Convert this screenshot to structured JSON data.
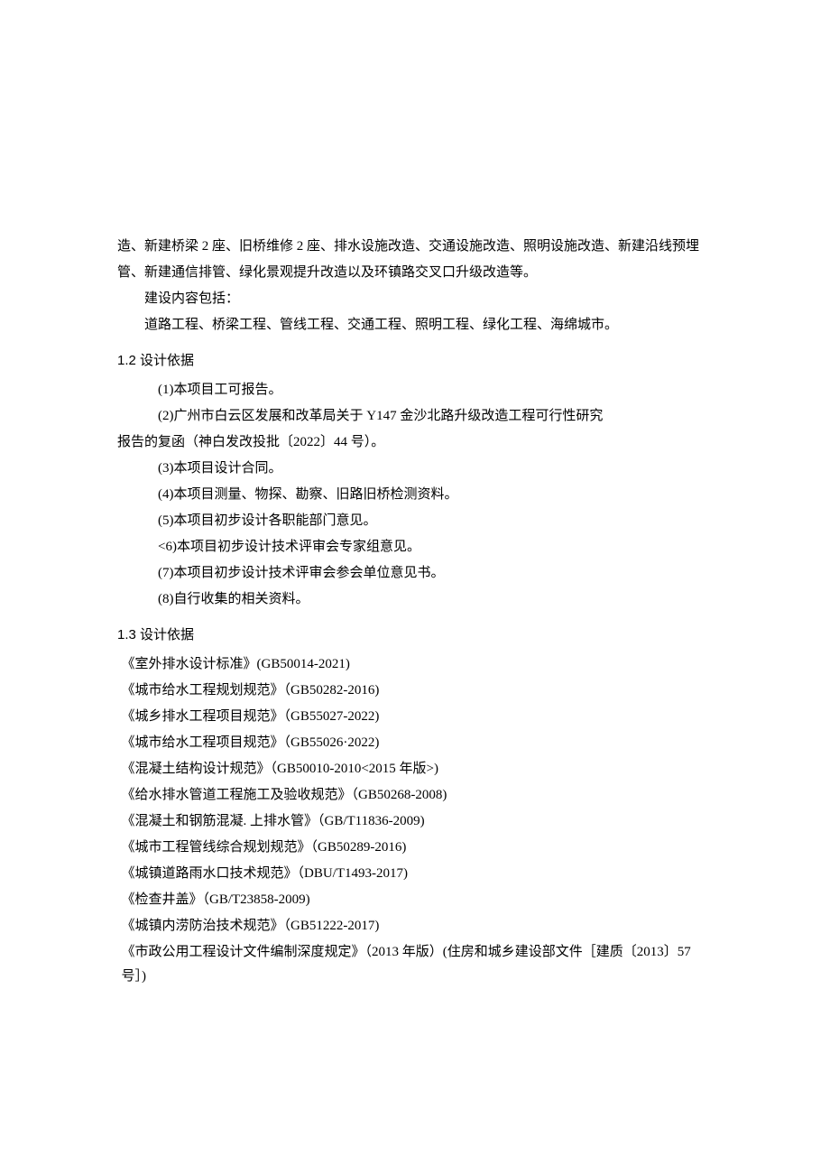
{
  "intro": {
    "p1": "造、新建桥梁 2 座、旧桥维修 2 座、排水设施改造、交通设施改造、照明设施改造、新建沿线预埋",
    "p2": "管、新建通信排管、绿化景观提升改造以及环镇路交叉口升级改造等。",
    "p3": "建设内容包括：",
    "p4": "道路工程、桥梁工程、管线工程、交通工程、照明工程、绿化工程、海绵城市。"
  },
  "section12": {
    "heading": "1.2 设计依据",
    "items": [
      "(1)本项目工可报告。",
      "(2)广州市白云区发展和改革局关于 Y147 金沙北路升级改造工程可行性研究"
    ],
    "line2b": "报告的复函（神白发改投批〔2022〕44 号）。",
    "items2": [
      "(3)本项目设计合同。",
      "(4)本项目测量、物探、勘察、旧路旧桥检测资料。",
      "(5)本项目初步设计各职能部门意见。",
      "<6)本项目初步设计技术评审会专家组意见。",
      "(7)本项目初步设计技术评审会参会单位意见书。",
      "(8)自行收集的相关资料。"
    ]
  },
  "section13": {
    "heading": "1.3 设计依据",
    "standards": [
      "《室外排水设计标准》(GB50014-2021)",
      "《城市给水工程规划规范》（GB50282-2016)",
      "《城乡排水工程项目规范》（GB55027-2022)",
      "《城市给水工程项目规范》（GB55026·2022)",
      "《混凝土结构设计规范》（GB50010-2010<2015 年版>)",
      "《给水排水管道工程施工及验收规范》（GB50268-2008)",
      "《混凝土和钢筋混凝. 上排水管》（GB/T11836-2009)",
      "《城市工程管线综合规划规范》（GB50289-2016)",
      "《城镇道路雨水口技术规范》（DBU/T1493-2017)",
      "《检查井盖》（GB/T23858-2009)",
      "《城镇内涝防治技术规范》（GB51222-2017)",
      "《市政公用工程设计文件编制深度规定》（2013 年版）(住房和城乡建设部文件［建质〔2013〕57 号］)"
    ]
  }
}
